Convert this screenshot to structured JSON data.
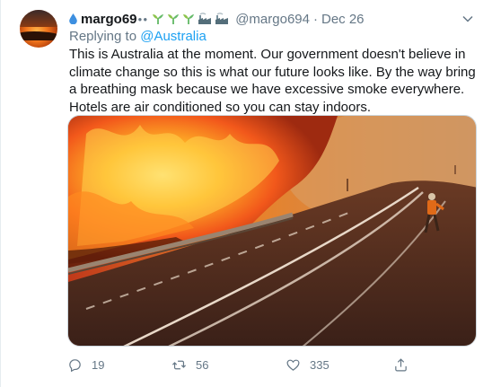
{
  "author": {
    "display_name": "margo69",
    "handle": "@margo694",
    "separator": "·",
    "date": "Dec 26",
    "decor_icons": [
      "water-drop-icon",
      "dots-icon",
      "seedling-icon",
      "seedling-icon",
      "seedling-icon",
      "factory-icon",
      "factory-icon"
    ]
  },
  "reply": {
    "prefix": "Replying to",
    "target": "@Australia"
  },
  "tweet_text": "This is Australia at the moment. Our government doesn't believe in climate change so this is what our future looks like. By the way bring a breathing mask because we have excessive smoke everywhere. Hotels are air conditioned so you can stay indoors.",
  "media": {
    "description_icon": "bushfire-photo"
  },
  "actions": {
    "replies": "19",
    "retweets": "56",
    "likes": "335"
  },
  "colors": {
    "link": "#1da1f2",
    "muted": "#657786",
    "text": "#14171a"
  }
}
